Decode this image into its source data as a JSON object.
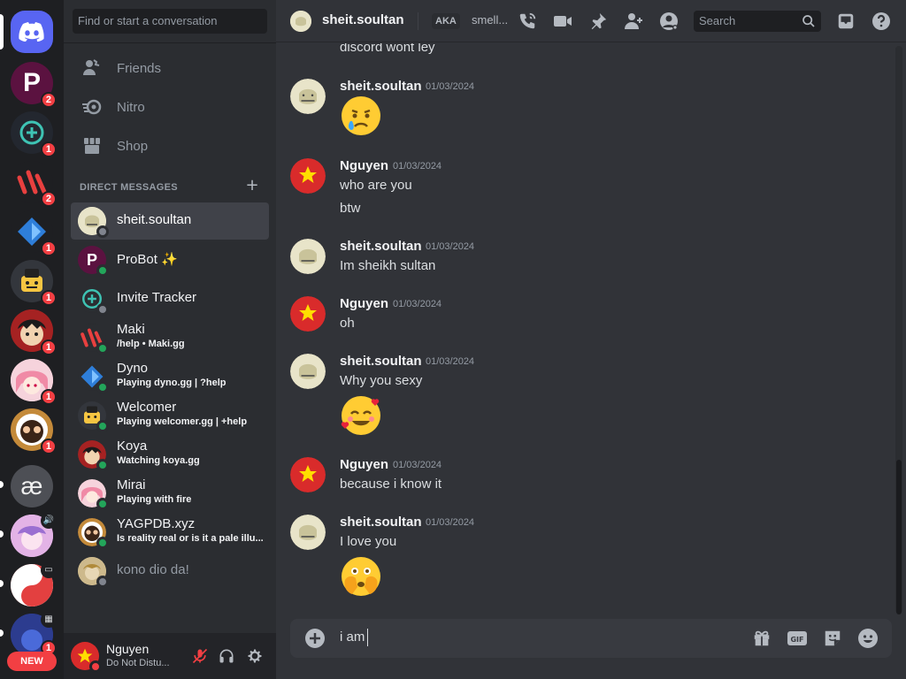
{
  "servers": [
    {
      "name": "Home",
      "badge": null,
      "icon": "discord-logo-icon"
    },
    {
      "name": "ProBot",
      "badge": "2",
      "color": "#6a1b4d"
    },
    {
      "name": "Invite Tracker",
      "badge": "1",
      "color": "#23272f"
    },
    {
      "name": "Maki",
      "badge": "2",
      "color": "#1e1f22"
    },
    {
      "name": "Dyno",
      "badge": "1",
      "color": "#1e1f22"
    },
    {
      "name": "Welcomer",
      "badge": "1",
      "color": "#2c2f35"
    },
    {
      "name": "Koya",
      "badge": "1",
      "color": "#5a1a1a"
    },
    {
      "name": "Mirai",
      "badge": "1",
      "color": "#f3c7cf"
    },
    {
      "name": "YAGPDB.xyz",
      "badge": "1",
      "color": "#3b2417"
    },
    {
      "name": "ae server",
      "badge": null,
      "label": "æ",
      "color": "#4d4f55"
    },
    {
      "name": "server 11",
      "badge": null,
      "color": "#d6a1d8"
    },
    {
      "name": "server 12",
      "badge": null,
      "color": "#e84b4b"
    },
    {
      "name": "server 13",
      "badge": "1",
      "color": "#23337a"
    }
  ],
  "new_badge": "NEW",
  "sidebar": {
    "search_placeholder": "Find or start a conversation",
    "nav": [
      {
        "label": "Friends",
        "icon": "friends-icon"
      },
      {
        "label": "Nitro",
        "icon": "nitro-icon"
      },
      {
        "label": "Shop",
        "icon": "shop-icon"
      }
    ],
    "dm_header": "DIRECT MESSAGES",
    "dms": [
      {
        "name": "sheit.soultan",
        "sub": "",
        "status": "offline",
        "active": true
      },
      {
        "name": "ProBot ✨",
        "sub": "",
        "status": "online"
      },
      {
        "name": "Invite Tracker",
        "sub": "",
        "status": "offline"
      },
      {
        "name": "Maki",
        "sub": "/help • Maki.gg",
        "status": "online"
      },
      {
        "name": "Dyno",
        "sub": "Playing dyno.gg | ?help",
        "status": "online"
      },
      {
        "name": "Welcomer",
        "sub": "Playing welcomer.gg | +help",
        "status": "online"
      },
      {
        "name": "Koya",
        "sub": "Watching koya.gg",
        "status": "online"
      },
      {
        "name": "Mirai",
        "sub": "Playing with fire",
        "status": "online"
      },
      {
        "name": "YAGPDB.xyz",
        "sub": "Is reality real or is it a pale illu...",
        "status": "online"
      },
      {
        "name": "kono dio da!",
        "sub": "",
        "status": "offline"
      }
    ]
  },
  "user_panel": {
    "name": "Nguyen",
    "status": "Do Not Distu..."
  },
  "header": {
    "name": "sheit.soultan",
    "aka": "AKA",
    "aka_value": "smell...",
    "search_placeholder": "Search"
  },
  "messages": [
    {
      "author": "",
      "time": "",
      "lines": [
        "discord wont ley"
      ]
    },
    {
      "author": "sheit.soultan",
      "time": "01/03/2024",
      "lines": [],
      "emoji": "crying-face"
    },
    {
      "author": "Nguyen",
      "time": "01/03/2024",
      "lines": [
        "who are you",
        "btw"
      ]
    },
    {
      "author": "sheit.soultan",
      "time": "01/03/2024",
      "lines": [
        "Im sheikh sultan"
      ]
    },
    {
      "author": "Nguyen",
      "time": "01/03/2024",
      "lines": [
        "oh"
      ]
    },
    {
      "author": "sheit.soultan",
      "time": "01/03/2024",
      "lines": [
        "Why you sexy"
      ],
      "emoji": "smiling-face-with-hearts"
    },
    {
      "author": "Nguyen",
      "time": "01/03/2024",
      "lines": [
        "because i know it"
      ]
    },
    {
      "author": "sheit.soultan",
      "time": "01/03/2024",
      "lines": [
        "I love you"
      ],
      "emoji": "face-with-open-eyes-and-hand-over-mouth"
    }
  ],
  "composer": {
    "text": "i am"
  },
  "colors": {
    "accent": "#5865f2",
    "danger": "#f23f43",
    "online": "#23a55a"
  }
}
